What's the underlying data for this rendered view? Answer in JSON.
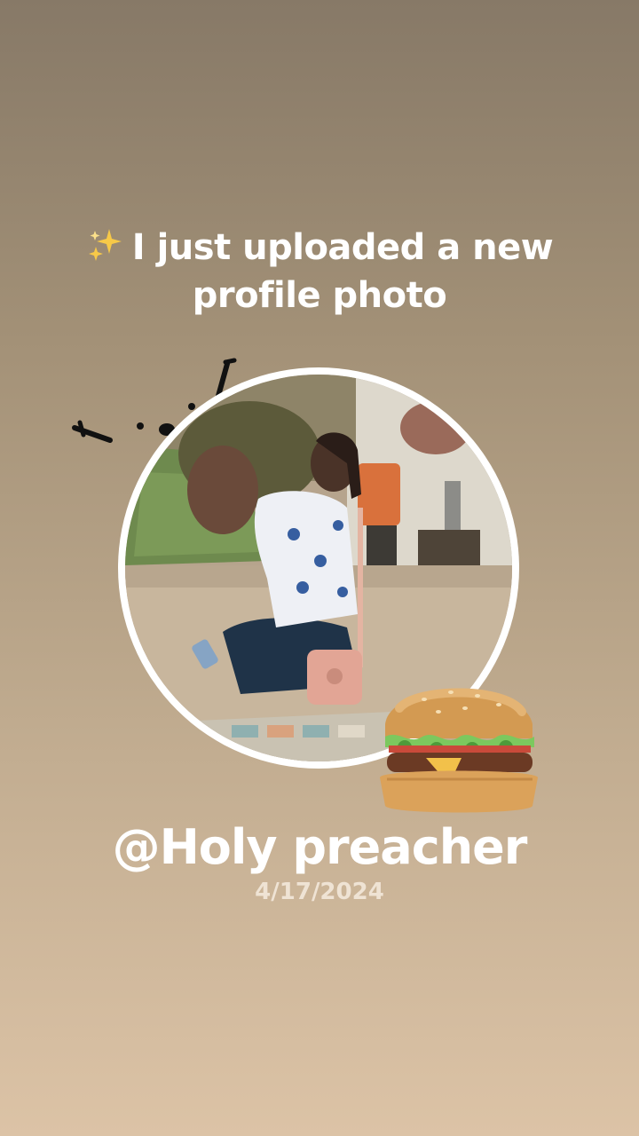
{
  "post": {
    "headline_icon": "sparkles-icon",
    "headline": "I just uploaded a new profile photo",
    "username": "@Holy preacher",
    "date": "4/17/2024"
  },
  "stickers": {
    "burger": "hamburger-sticker",
    "doodle": "face-doodle"
  },
  "colors": {
    "background_top": "#877967",
    "background_bottom": "#dcc3a6",
    "text": "#ffffff",
    "date_text": "#efe3d4",
    "photo_ring": "#ffffff"
  }
}
